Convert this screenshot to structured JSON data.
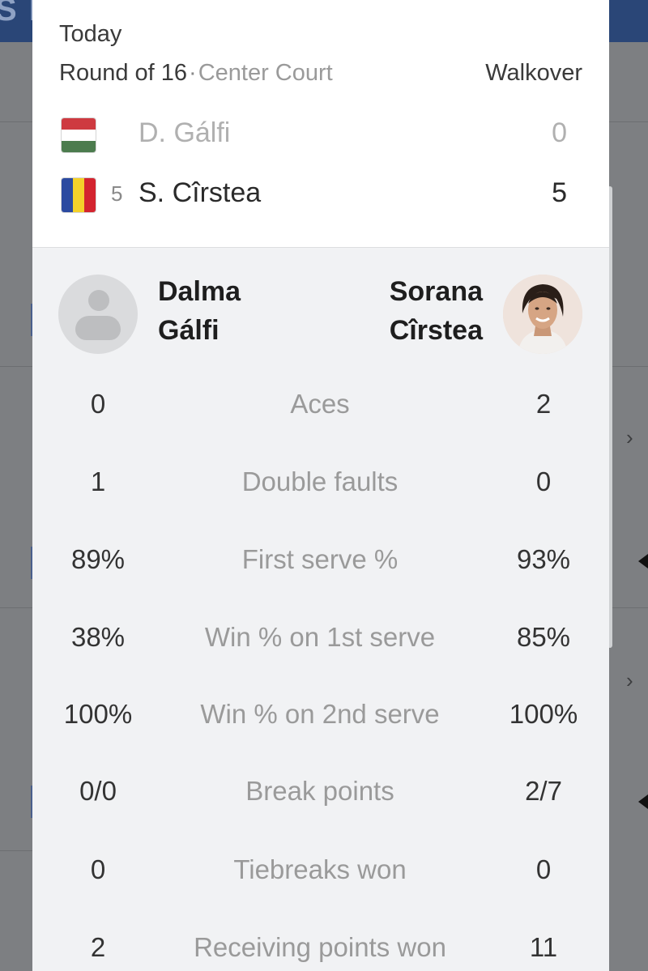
{
  "background": {
    "logo_fragment": "S M",
    "accent_color": "#2a4677"
  },
  "match": {
    "date": "Today",
    "round": "Round of 16",
    "separator": "·",
    "court": "Center Court",
    "status": "Walkover",
    "player1": {
      "short_name": "D. Gálfi",
      "score": "0",
      "flag": "hungary-flag-icon"
    },
    "player2": {
      "seed": "5",
      "short_name": "S. Cîrstea",
      "score": "5",
      "flag": "romania-flag-icon"
    }
  },
  "players": {
    "left": {
      "first": "Dalma",
      "last": "Gálfi",
      "avatar": "placeholder-avatar-icon"
    },
    "right": {
      "first": "Sorana",
      "last": "Cîrstea",
      "avatar": "player-photo"
    }
  },
  "stats": [
    {
      "label": "Aces",
      "left": "0",
      "right": "2"
    },
    {
      "label": "Double faults",
      "left": "1",
      "right": "0"
    },
    {
      "label": "First serve %",
      "left": "89%",
      "right": "93%"
    },
    {
      "label": "Win % on 1st serve",
      "left": "38%",
      "right": "85%"
    },
    {
      "label": "Win % on 2nd serve",
      "left": "100%",
      "right": "100%"
    },
    {
      "label": "Break points",
      "left": "0/0",
      "right": "2/7"
    },
    {
      "label": "Tiebreaks won",
      "left": "0",
      "right": "0"
    },
    {
      "label": "Receiving points won",
      "left": "2",
      "right": "11"
    }
  ]
}
